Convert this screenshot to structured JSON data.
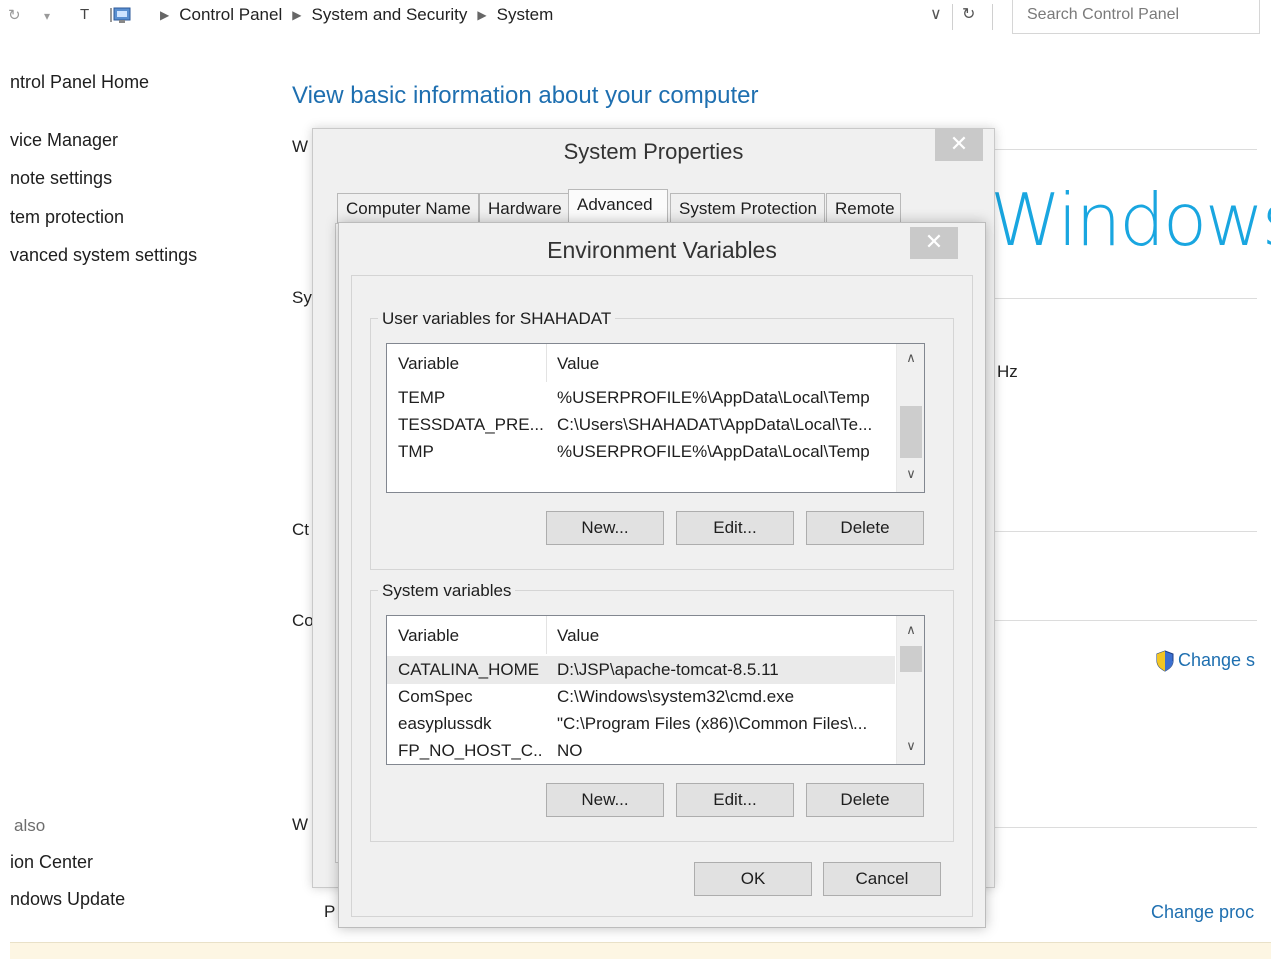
{
  "address_bar": {
    "back_glyph": "↻",
    "forward_glyph": "▾",
    "up_glyph": "T",
    "breadcrumbs": [
      "Control Panel",
      "System and Security",
      "System"
    ],
    "dropdown_glyph": "∨",
    "refresh_glyph": "↻",
    "search_placeholder": "Search Control Panel"
  },
  "sidebar": {
    "items": [
      "ntrol Panel Home",
      "vice Manager",
      "note settings",
      "tem protection",
      "vanced system settings"
    ],
    "see_also_label": "also",
    "see_also_items": [
      "ion Center",
      "ndows Update"
    ]
  },
  "main": {
    "title": "View basic information about your computer",
    "section_letters": [
      "W",
      "Sy",
      "Ct",
      "Co",
      "W",
      "P"
    ],
    "windows_logo_text": "Windows",
    "hz_text": "Hz",
    "change_settings_link": "Change s",
    "change_product_link": "Change proc"
  },
  "system_properties": {
    "title": "System Properties",
    "close_glyph": "✕",
    "tabs": [
      {
        "label": "Computer Name"
      },
      {
        "label": "Hardware"
      },
      {
        "label": "Advanced",
        "active": true
      },
      {
        "label": "System Protection"
      },
      {
        "label": "Remote"
      }
    ]
  },
  "env_vars": {
    "title": "Environment Variables",
    "close_glyph": "✕",
    "user_group_label": "User variables for SHAHADAT",
    "system_group_label": "System variables",
    "col_variable": "Variable",
    "col_value": "Value",
    "user_rows": [
      {
        "variable": "TEMP",
        "value": "%USERPROFILE%\\AppData\\Local\\Temp"
      },
      {
        "variable": "TESSDATA_PRE...",
        "value": "C:\\Users\\SHAHADAT\\AppData\\Local\\Te..."
      },
      {
        "variable": "TMP",
        "value": "%USERPROFILE%\\AppData\\Local\\Temp"
      }
    ],
    "system_rows": [
      {
        "variable": "CATALINA_HOME",
        "value": "D:\\JSP\\apache-tomcat-8.5.11",
        "selected": true
      },
      {
        "variable": "ComSpec",
        "value": "C:\\Windows\\system32\\cmd.exe"
      },
      {
        "variable": "easyplussdk",
        "value": "\"C:\\Program Files (x86)\\Common Files\\..."
      },
      {
        "variable": "FP_NO_HOST_C...",
        "value": "NO"
      }
    ],
    "scroll_up_glyph": "∧",
    "scroll_down_glyph": "∨",
    "buttons": {
      "new": "New...",
      "edit": "Edit...",
      "delete": "Delete",
      "ok": "OK",
      "cancel": "Cancel"
    }
  }
}
